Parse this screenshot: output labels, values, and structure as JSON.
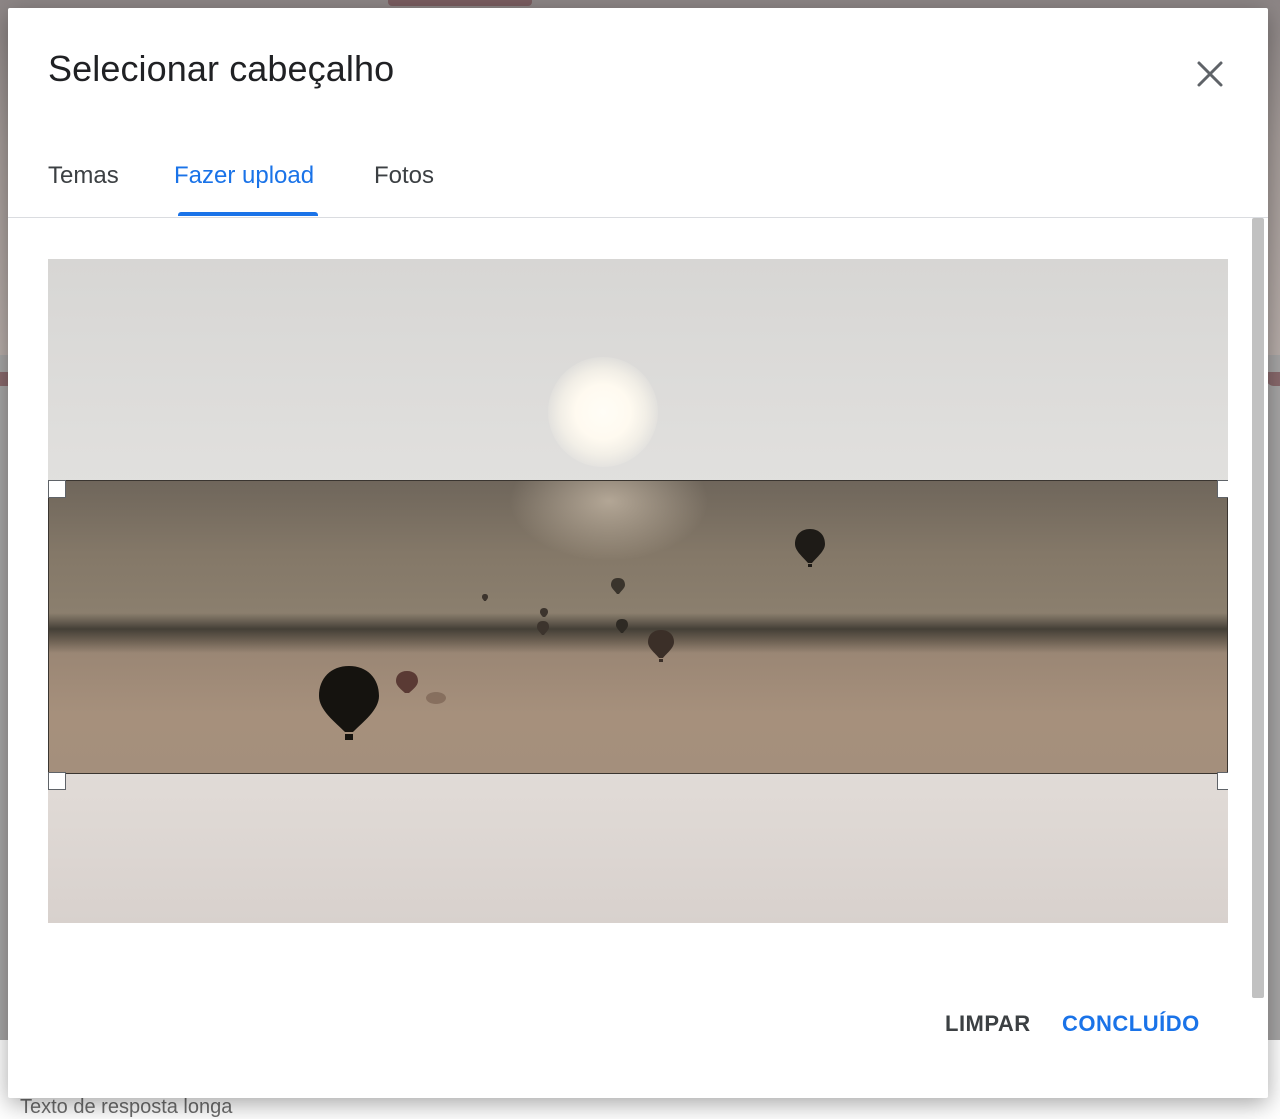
{
  "background": {
    "long_answer_placeholder": "Texto de resposta longa"
  },
  "dialog": {
    "title": "Selecionar cabeçalho",
    "close_icon": "close-icon",
    "tabs": [
      {
        "label": "Temas",
        "active": false
      },
      {
        "label": "Fazer upload",
        "active": true
      },
      {
        "label": "Fotos",
        "active": false
      }
    ],
    "image": {
      "description_icon": "uploaded-photo-hot-air-balloons"
    },
    "buttons": {
      "clear": "LIMPAR",
      "done": "CONCLUÍDO"
    }
  },
  "colors": {
    "accent": "#1a73e8",
    "title": "#202124",
    "tab_inactive": "#3c4043"
  }
}
